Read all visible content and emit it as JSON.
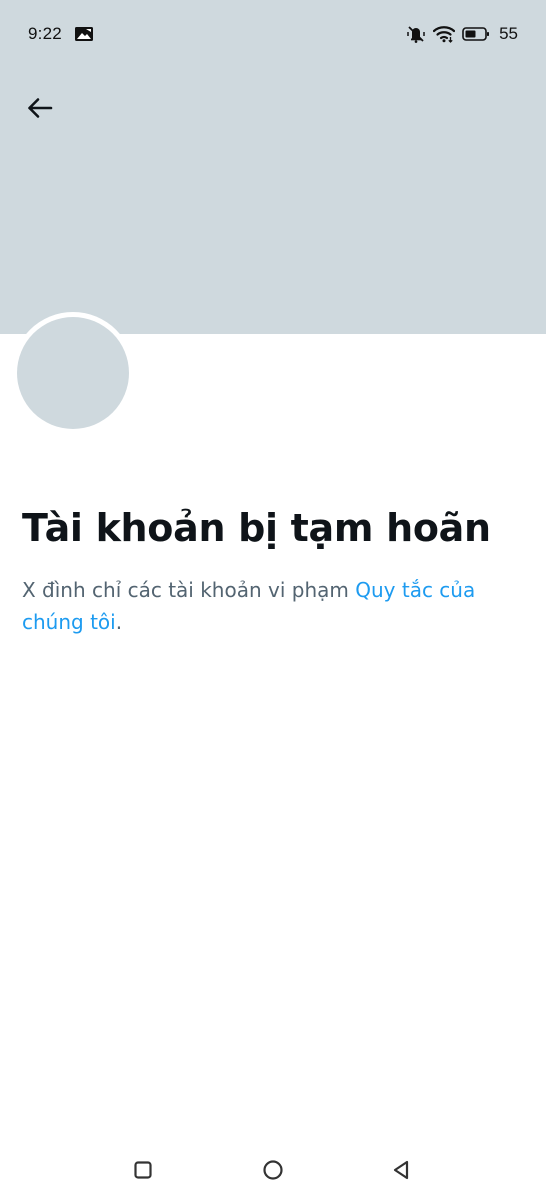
{
  "status_bar": {
    "time": "9:22",
    "battery_level": "55",
    "icons": [
      "gallery-icon",
      "mute-vibrate-icon",
      "wifi-icon",
      "battery-icon"
    ]
  },
  "header": {
    "back_icon": "arrow-left-icon",
    "banner_color": "#cfd9de"
  },
  "profile": {
    "title": "Tài khoản bị tạm hoãn",
    "description_prefix": "X đình chỉ các tài khoản vi phạm ",
    "rules_link": "Quy tắc của chúng tôi",
    "description_suffix": "."
  },
  "nav_bar": {
    "icons": [
      "recent-apps-icon",
      "home-icon",
      "back-triangle-icon"
    ]
  },
  "colors": {
    "banner": "#cfd9de",
    "title": "#0f1419",
    "body_text": "#536471",
    "link": "#1d9bf0"
  }
}
